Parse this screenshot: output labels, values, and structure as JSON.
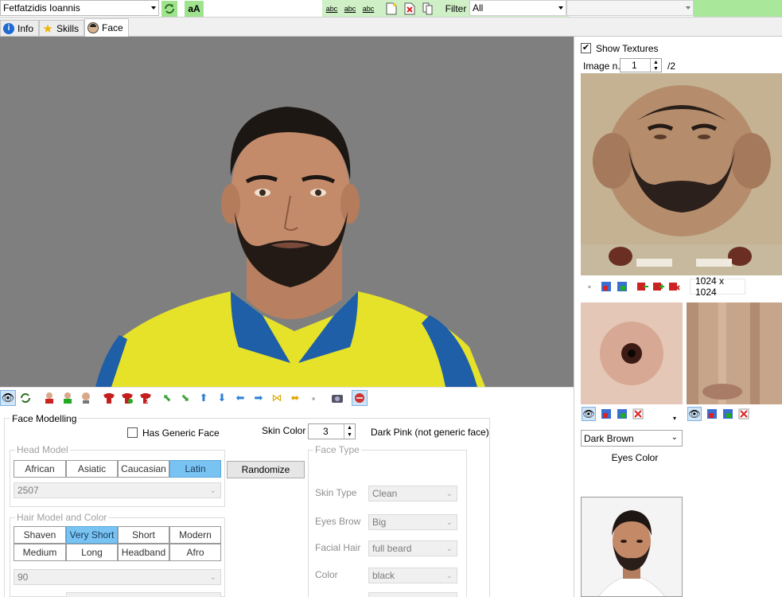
{
  "toolbar": {
    "player_name": "Fetfatzidis Ioannis",
    "case_label": "aA",
    "abc1": "abc",
    "abc2": "abc",
    "abc3": "abc",
    "filter_label": "Filter",
    "filter_value": "All",
    "secondary_value": ""
  },
  "tabs": [
    {
      "label": "Info",
      "icon": "info-icon"
    },
    {
      "label": "Skills",
      "icon": "star-icon"
    },
    {
      "label": "Face",
      "icon": "face-icon"
    }
  ],
  "face_modelling": {
    "title": "Face Modelling",
    "has_generic_face_label": "Has Generic Face",
    "has_generic_face_checked": false,
    "skin_color_label": "Skin Color",
    "skin_color_value": "3",
    "skin_color_desc": "Dark Pink (not generic face)",
    "head_model": {
      "title": "Head Model",
      "options": [
        "African",
        "Asiatic",
        "Caucasian",
        "Latin"
      ],
      "selected": "Latin",
      "randomize_label": "Randomize",
      "value": "2507"
    },
    "hair_model": {
      "title": "Hair Model and Color",
      "options": [
        "Shaven",
        "Very Short",
        "Short",
        "Modern",
        "Medium",
        "Long",
        "Headband",
        "Afro"
      ],
      "selected": "Very Short",
      "value": "90"
    },
    "face_type": {
      "title": "Face Type",
      "skin_type_label": "Skin Type",
      "skin_type_value": "Clean",
      "eyes_brow_label": "Eyes Brow",
      "eyes_brow_value": "Big",
      "facial_hair_label": "Facial Hair",
      "facial_hair_value": "full beard",
      "color_label": "Color",
      "color_value": "black"
    }
  },
  "textures": {
    "show_textures_label": "Show Textures",
    "show_textures_checked": true,
    "image_n_label": "Image n.",
    "image_n_value": "1",
    "image_total": "/2",
    "resolution": "1024 x 1024",
    "eyes_color_value": "Dark Brown",
    "eyes_color_label": "Eyes Color"
  },
  "colors": {
    "viewport_bg": "#7f7f7f",
    "selected_seg": "#79c3f3",
    "shirt_yellow": "#e8e42a",
    "shirt_blue": "#1f5fa8"
  }
}
